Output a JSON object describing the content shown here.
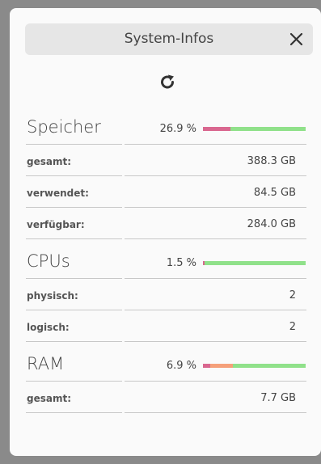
{
  "header": {
    "title": "System-Infos"
  },
  "sections": {
    "storage": {
      "title": "Speicher",
      "percent_text": "26.9 %",
      "used_fraction": 0.269,
      "rows": [
        {
          "label": "gesamt:",
          "value": "388.3 GB"
        },
        {
          "label": "verwendet:",
          "value": "84.5 GB"
        },
        {
          "label": "verfügbar:",
          "value": "284.0 GB"
        }
      ]
    },
    "cpus": {
      "title": "CPUs",
      "percent_text": "1.5 %",
      "used_fraction": 0.015,
      "rows": [
        {
          "label": "physisch:",
          "value": "2"
        },
        {
          "label": "logisch:",
          "value": "2"
        }
      ]
    },
    "ram": {
      "title": "RAM",
      "percent_text": "6.9 %",
      "used_fraction": 0.069,
      "secondary_fraction": 0.22,
      "rows": [
        {
          "label": "gesamt:",
          "value": "7.7 GB"
        }
      ]
    }
  },
  "colors": {
    "used": "#d9678f",
    "secondary": "#f5a07a",
    "free": "#90e18a"
  }
}
